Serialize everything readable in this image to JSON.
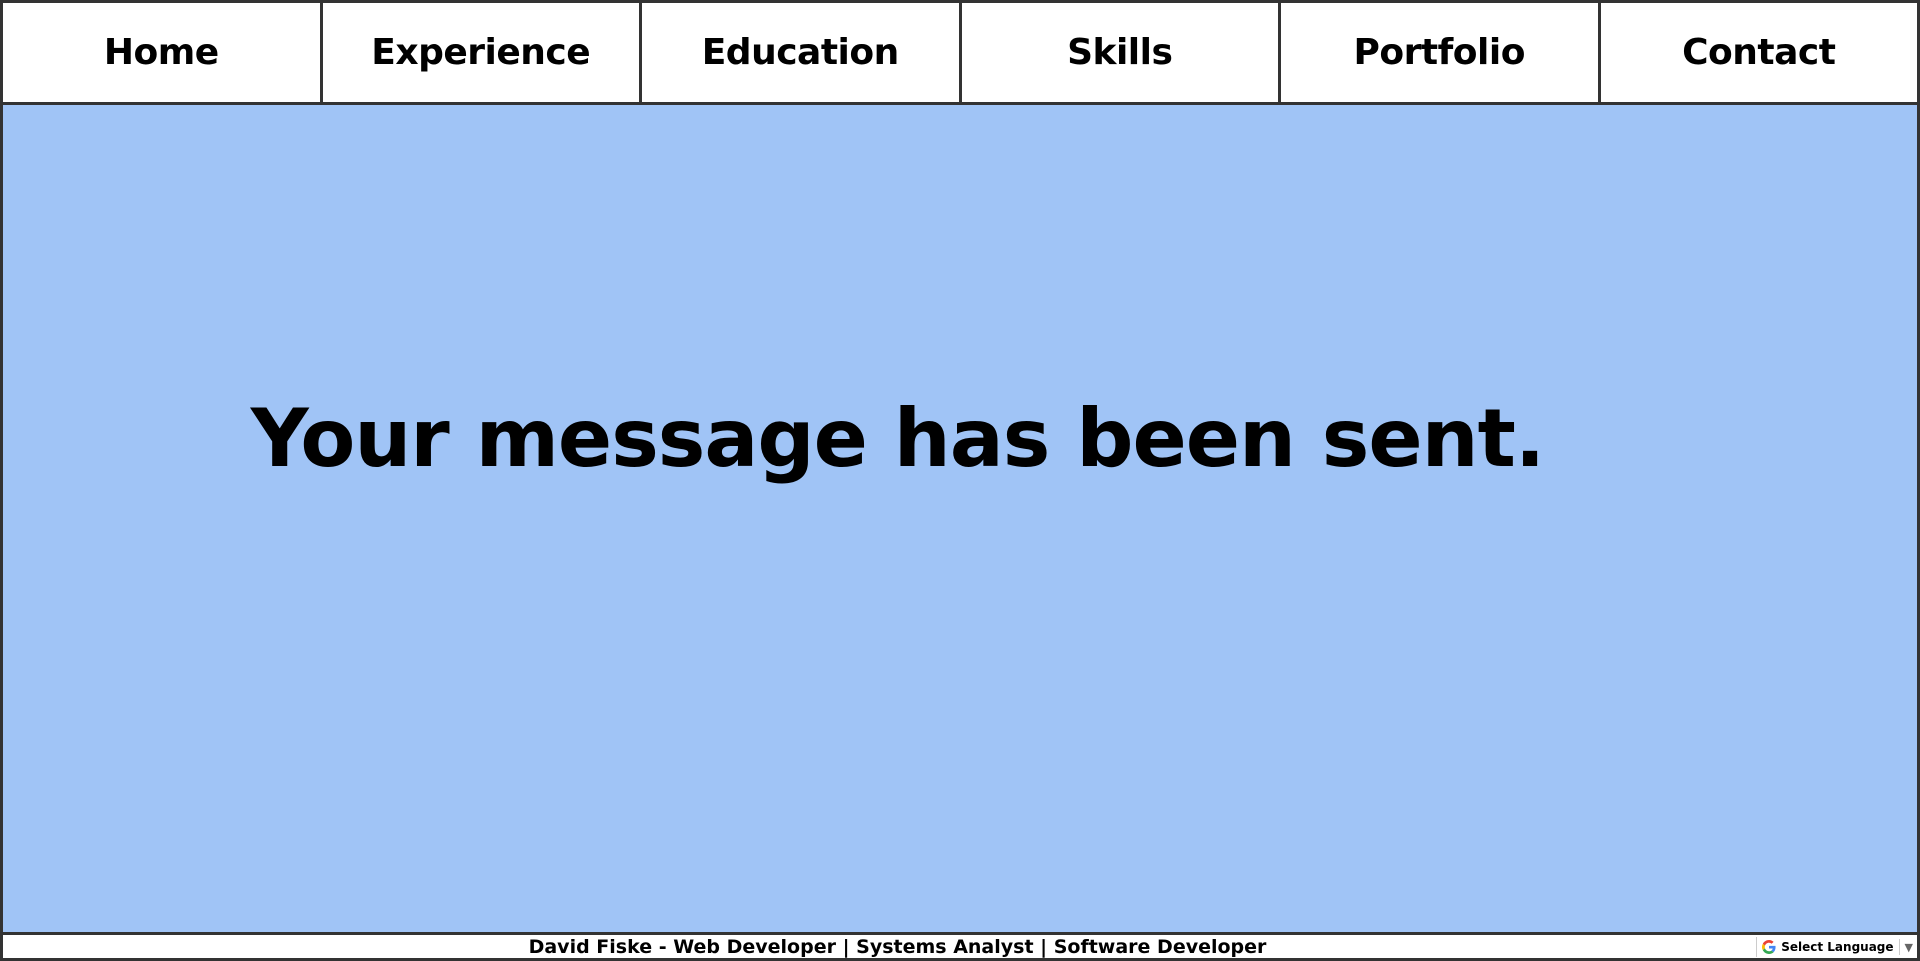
{
  "nav": {
    "items": [
      {
        "label": "Home"
      },
      {
        "label": "Experience"
      },
      {
        "label": "Education"
      },
      {
        "label": "Skills"
      },
      {
        "label": "Portfolio"
      },
      {
        "label": "Contact"
      }
    ]
  },
  "main": {
    "message": "Your message has been sent.",
    "background_color": "#a0c4f6"
  },
  "footer": {
    "text": "David Fiske - Web Developer | Systems Analyst | Software Developer",
    "language_selector": {
      "label": "Select Language",
      "icon": "google-g-icon",
      "arrow": "▼"
    }
  }
}
